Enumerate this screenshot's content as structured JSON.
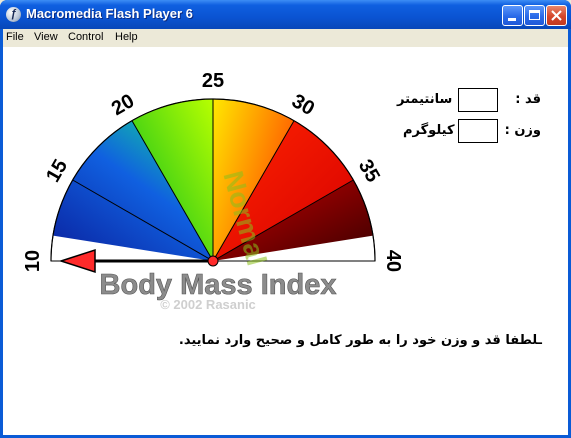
{
  "window": {
    "title": "Macromedia Flash Player 6",
    "title_icon": "flash-player-icon"
  },
  "menu": {
    "items": [
      "File",
      "View",
      "Control",
      "Help"
    ]
  },
  "gauge": {
    "tick_labels": [
      "10",
      "15",
      "20",
      "25",
      "30",
      "35",
      "40"
    ],
    "min": 10,
    "max": 40,
    "pointer_value": 10,
    "watermark": "Normal",
    "title": "Body Mass Index",
    "copyright": "© 2002 Rasanic",
    "colors": {
      "low": "#0a2fb8",
      "normal": "#7fd400",
      "high": "#ff1a00",
      "very_high": "#6b0000",
      "pointer": "#ff2a2a",
      "title_gray": "#8c8c8c"
    }
  },
  "form": {
    "height": {
      "label": "قد :",
      "unit": "سانتیمتر",
      "value": ""
    },
    "weight": {
      "label": "وزن :",
      "unit": "کیلوگرم",
      "value": ""
    }
  },
  "instruction": "ـلطفا قد و وزن خود را به طور کامل و صحیح وارد نمایید."
}
